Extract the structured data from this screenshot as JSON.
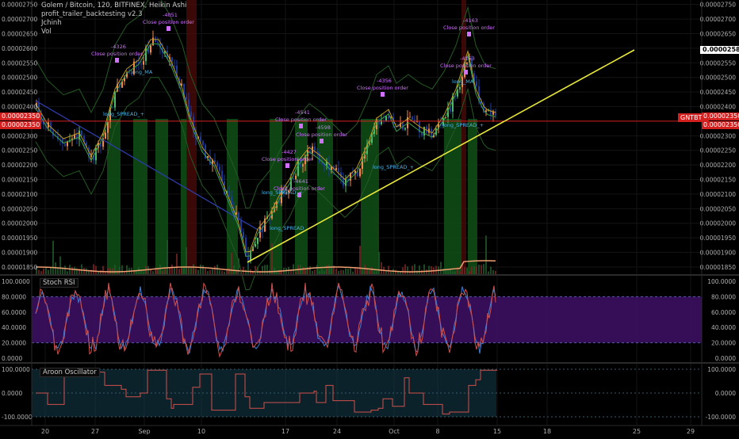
{
  "legend": {
    "title": "Golem / Bitcoin, 120, BITFINEX, Heikin Ashi",
    "studies": [
      "profit_trailer_backtesting v2.3",
      "Jchinh",
      "Vol"
    ]
  },
  "colors": {
    "background": "#000000",
    "bull": "#f0894a",
    "bear": "#1c3c9c",
    "candle_green": "#4dbb6a",
    "trendline": "#e8e83a",
    "price_line": "#d41f1f",
    "stoch_k": "#3f7fd6",
    "stoch_d": "#d0504a",
    "stoch_band": "#3c1060",
    "aroon": "#d0504a",
    "aroon_fill": "#123848",
    "signal_text": "#d070ff",
    "band_green": "#0f4a16"
  },
  "price_axis": {
    "ticks": [
      "0.00002750",
      "0.00002700",
      "0.00002650",
      "0.00002600",
      "0.00002550",
      "0.00002500",
      "0.00002450",
      "0.00002400",
      "0.00002300",
      "0.00002250",
      "0.00002200",
      "0.00002150",
      "0.00002100",
      "0.00002050",
      "0.00002000",
      "0.00001950",
      "0.00001900",
      "0.00001850"
    ],
    "highlight": "0.00002585",
    "last_price": "0.00002350",
    "symbol": "GNTBTC"
  },
  "signals": {
    "close_label": "Close position order",
    "long_ma": "long_MA",
    "long_spread": "long_SPREAD_+",
    "long_spread_plain": "long_SPREAD",
    "ids": [
      "-4326",
      "-4051",
      "-4356",
      "-4541",
      "-4598",
      "-4427",
      "-4163",
      "-4216",
      "-4641",
      "-4214",
      "-4326"
    ]
  },
  "stoch": {
    "title": "Stoch RSI",
    "ticks": [
      "100.0000",
      "80.0000",
      "60.0000",
      "40.0000",
      "20.0000",
      "0.0000"
    ]
  },
  "aroon": {
    "title": "Aroon Oscillator",
    "ticks": [
      "100.0000",
      "0.0000",
      "-100.0000"
    ]
  },
  "time_axis": [
    "20",
    "27",
    "Sep",
    "10",
    "17",
    "24",
    "Oct",
    "8",
    "15",
    "18",
    "25",
    "29"
  ]
}
